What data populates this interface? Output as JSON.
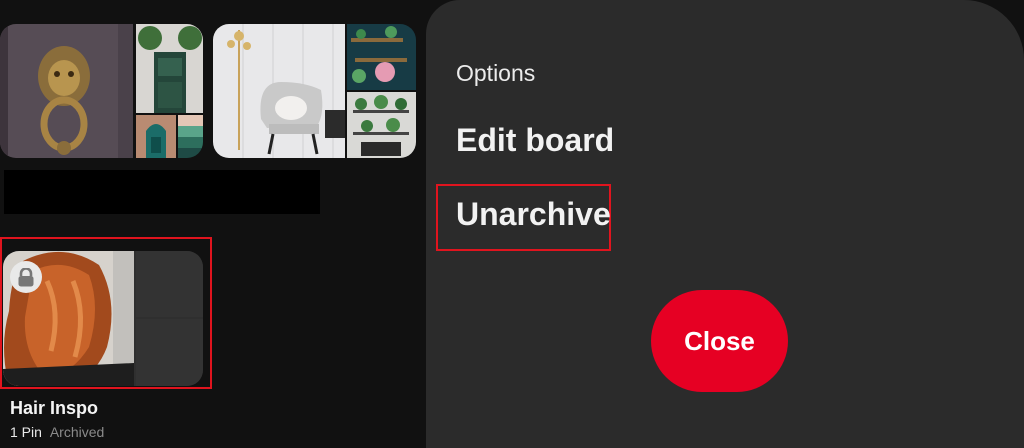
{
  "boards": [
    {
      "name": "",
      "images": [
        "lion-door-knocker",
        "green-front-door",
        "arched-window",
        "color-swatches"
      ]
    },
    {
      "name": "",
      "images": [
        "white-armchair-with-floor-lamp",
        "wall-shelves-with-plants",
        "plant-shelf-room"
      ]
    }
  ],
  "archived_board": {
    "name": "Hair Inspo",
    "pin_count": "1 Pin",
    "status": "Archived",
    "image": "copper-wavy-hair",
    "lock_icon": "lock-icon"
  },
  "options_sheet": {
    "heading": "Options",
    "items": [
      {
        "label": "Edit board"
      },
      {
        "label": "Unarchive"
      }
    ],
    "close_label": "Close"
  },
  "colors": {
    "background": "#111111",
    "sheet": "#2b2b2b",
    "accent_red": "#e60023",
    "highlight_red": "#e0141e"
  }
}
